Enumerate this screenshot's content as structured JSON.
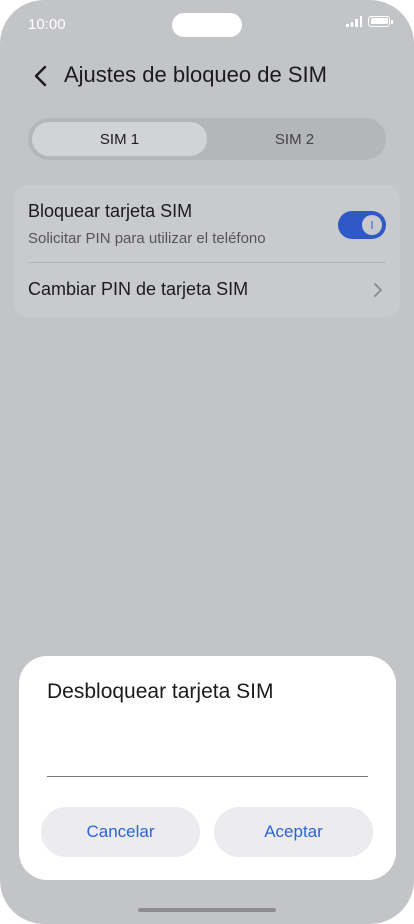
{
  "status_bar": {
    "time": "10:00"
  },
  "header": {
    "title": "Ajustes de bloqueo de SIM"
  },
  "sim_tabs": [
    {
      "label": "SIM 1",
      "selected": true
    },
    {
      "label": "SIM 2",
      "selected": false
    }
  ],
  "settings": {
    "lock_sim": {
      "title": "Bloquear tarjeta SIM",
      "subtitle": "Solicitar PIN para utilizar el teléfono",
      "enabled": true
    },
    "change_pin": {
      "title": "Cambiar PIN de tarjeta SIM"
    }
  },
  "dialog": {
    "title": "Desbloquear tarjeta SIM",
    "pin_value": "",
    "cancel_label": "Cancelar",
    "accept_label": "Aceptar"
  },
  "colors": {
    "accent": "#2f59c6",
    "button_text": "#2b63d9",
    "dim_background": "#c3c4c8"
  }
}
